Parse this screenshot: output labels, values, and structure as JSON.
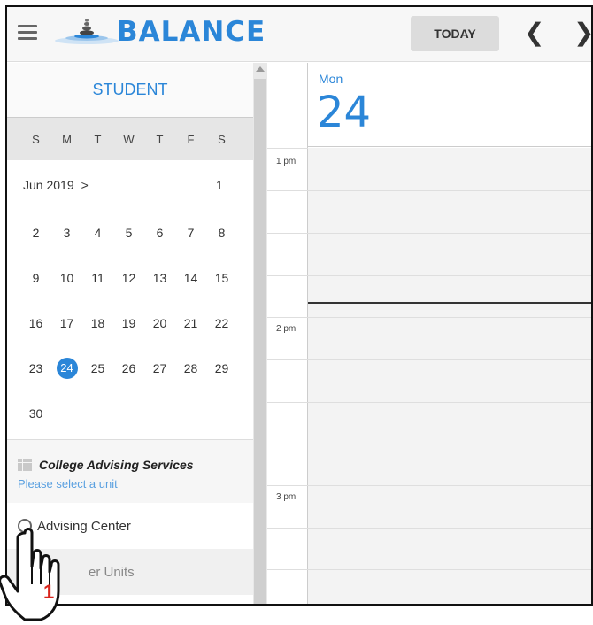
{
  "header": {
    "brand": "BALANCE",
    "today_label": "TODAY",
    "prev_icon": "chevron-left-icon",
    "next_icon": "chevron-right-icon",
    "prev_glyph": "❮",
    "next_glyph": "❯"
  },
  "sidebar": {
    "role": "STUDENT",
    "weekdays": [
      "S",
      "M",
      "T",
      "W",
      "T",
      "F",
      "S"
    ],
    "month_label": "Jun 2019",
    "month_arrow": ">",
    "first_day": "1",
    "weeks": [
      [
        "2",
        "3",
        "4",
        "5",
        "6",
        "7",
        "8"
      ],
      [
        "9",
        "10",
        "11",
        "12",
        "13",
        "14",
        "15"
      ],
      [
        "16",
        "17",
        "18",
        "19",
        "20",
        "21",
        "22"
      ],
      [
        "23",
        "24",
        "25",
        "26",
        "27",
        "28",
        "29"
      ],
      [
        "30"
      ]
    ],
    "selected_day": "24",
    "unit_title": "College Advising Services",
    "unit_hint": "Please select a unit",
    "unit_option": "Advising Center",
    "other_units": "er Units"
  },
  "day_view": {
    "day_name": "Mon",
    "day_number": "24",
    "times": [
      "1 pm",
      "2 pm",
      "3 pm"
    ]
  },
  "annotation": {
    "step": "1"
  },
  "colors": {
    "accent": "#2b86d8",
    "step": "#d9241c"
  }
}
